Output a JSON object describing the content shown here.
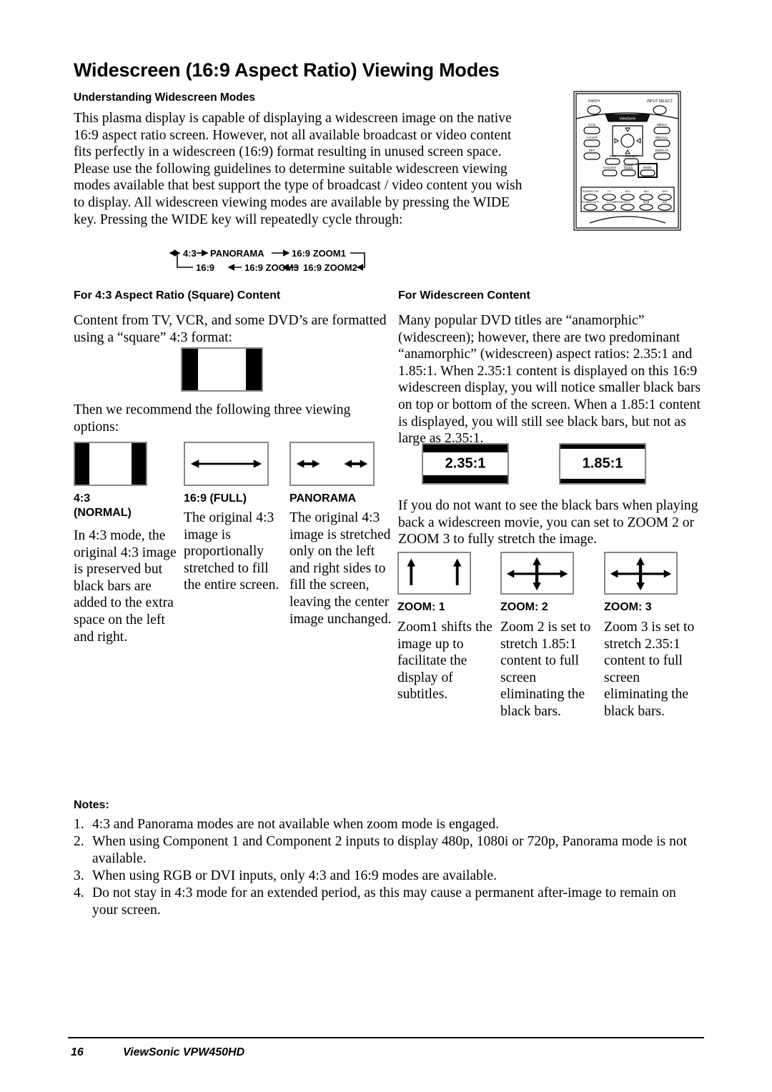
{
  "document": {
    "title": "Widescreen (16:9 Aspect Ratio) Viewing Modes",
    "subtitle": "Understanding Widescreen Modes",
    "intro": "This plasma display is capable of displaying a widescreen image on the native 16:9 aspect ratio screen.  However, not all available broadcast or video content fits perfectly in a widescreen (16:9) format resulting in unused screen space.  Please use the following guidelines to determine suitable widescreen viewing modes available that best support the type of broadcast / video content you wish to display.  All widescreen viewing modes are available by pressing the WIDE key.  Pressing the WIDE key will repeatedly cycle through:"
  },
  "cycle_diagram": {
    "row1": [
      "4:3",
      "PANORAMA",
      "16:9 ZOOM1"
    ],
    "row2": [
      "16:9",
      "16:9 ZOOM3",
      "16:9 ZOOM2"
    ]
  },
  "remote": {
    "name": "remote-control-illustration",
    "buttons": [
      "FM/CH",
      "INPUT SELECT",
      "CCD",
      "V-CHIP",
      "SET",
      "MTS",
      "FAVSET",
      "CH.LOCK",
      "SLEEP TIMER",
      "WIDE",
      "MENU",
      "RECALL",
      "DISPLAY",
      "POWER ON",
      "TV",
      "AV1",
      "AV2",
      "AV3",
      "POWER OFF",
      "1-COMPONENT-2",
      "RGB",
      "DVI"
    ],
    "highlighted_button": "WIDE"
  },
  "section_43": {
    "heading": "For 4:3 Aspect Ratio (Square) Content",
    "paragraph": "Content from TV, VCR, and some DVD’s are formatted using a “square” 4:3 format:",
    "then_paragraph": "Then we recommend the following three viewing options:",
    "modes": [
      {
        "label": "4:3\n(NORMAL)",
        "label_line1": "4:3",
        "label_line2": "(NORMAL)",
        "description": "In 4:3 mode, the original 4:3 image is preserved but black bars are added to the extra space on the left and right.",
        "diagram": "side-bars"
      },
      {
        "label_line1": "16:9 (FULL)",
        "label_line2": "",
        "description": "The original 4:3 image is proportionally stretched to fill the entire screen.",
        "diagram": "horizontal-arrow"
      },
      {
        "label_line1": "PANORAMA",
        "label_line2": "",
        "description": "The original 4:3 image is stretched only on the left and right sides to fill the screen, leaving the center image unchanged.",
        "diagram": "two-side-arrows"
      }
    ]
  },
  "section_widescreen": {
    "heading": "For Widescreen Content",
    "paragraph": "Many popular DVD titles are “anamorphic” (widescreen); however, there are two predominant “anamorphic” (widescreen) aspect ratios: 2.35:1 and 1.85:1.  When 2.35:1 content is displayed on this 16:9 widescreen display, you will notice smaller black bars on top or bottom of the screen.  When a 1.85:1 content is displayed, you will still see black bars, but not as large as 2.35:1.",
    "ratio_diagrams": [
      {
        "label": "2.35:1",
        "bar_thickness_pct": 20
      },
      {
        "label": "1.85:1",
        "bar_thickness_pct": 11
      }
    ],
    "zoom_intro": "If you do not want to see the black bars when playing back a widescreen movie, you can set to ZOOM 2 or ZOOM 3 to fully stretch the image.",
    "zoom_modes": [
      {
        "label": "ZOOM: 1",
        "description": "Zoom1 shifts the image up to facilitate the display of subtitles.",
        "diagram": "two-up-arrows"
      },
      {
        "label": "ZOOM: 2",
        "description": "Zoom 2 is set to stretch 1.85:1 content to full screen eliminating the black bars.",
        "diagram": "cross-arrows"
      },
      {
        "label": "ZOOM: 3",
        "description": "Zoom 3 is set to stretch 2.35:1 content to full screen eliminating the black bars.",
        "diagram": "cross-arrows"
      }
    ]
  },
  "notes": {
    "heading": "Notes:",
    "items": [
      {
        "num": "1.",
        "text": "4:3 and Panorama modes are not available when zoom mode is engaged."
      },
      {
        "num": "2.",
        "text": "When using Component 1 and Component 2 inputs to display 480p, 1080i or 720p, Panorama mode is not available."
      },
      {
        "num": "3.",
        "text": "When using RGB or DVI inputs, only 4:3 and 16:9 modes are available."
      },
      {
        "num": "4.",
        "text": "Do not stay in 4:3 mode for an extended period, as this may cause a permanent after-image to remain on your screen."
      }
    ]
  },
  "footer": {
    "page_number": "16",
    "model": "ViewSonic  VPW450HD"
  }
}
